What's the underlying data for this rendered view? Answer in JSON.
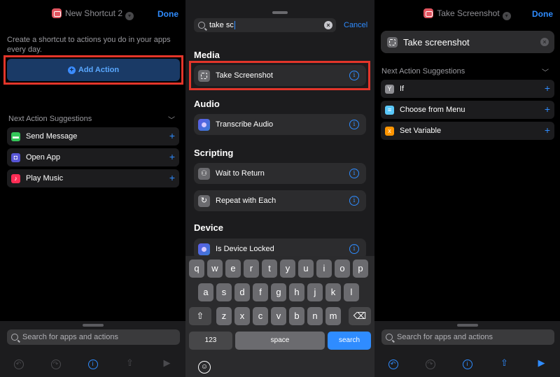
{
  "left_panel": {
    "title": "New Shortcut 2",
    "done_label": "Done",
    "intro_text": "Create a shortcut to actions you do in your apps every day.",
    "add_action_label": "Add Action",
    "suggestions_header": "Next Action Suggestions",
    "suggestions": [
      {
        "label": "Send Message",
        "icon": "message-icon",
        "color": "#34c759"
      },
      {
        "label": "Open App",
        "icon": "open-app-icon",
        "color": "#5856d6"
      },
      {
        "label": "Play Music",
        "icon": "music-icon",
        "color": "#ff2d55"
      }
    ],
    "search_placeholder": "Search for apps and actions"
  },
  "middle_panel": {
    "search_value": "take sc",
    "cancel_label": "Cancel",
    "sections": [
      {
        "title": "Media",
        "items": [
          {
            "label": "Take Screenshot",
            "icon": "screenshot-icon"
          }
        ]
      },
      {
        "title": "Audio",
        "items": [
          {
            "label": "Transcribe Audio",
            "icon": "transcribe-icon"
          }
        ]
      },
      {
        "title": "Scripting",
        "items": [
          {
            "label": "Wait to Return",
            "icon": "wait-icon"
          },
          {
            "label": "Repeat with Each",
            "icon": "repeat-icon"
          }
        ]
      },
      {
        "title": "Device",
        "items": [
          {
            "label": "Is Device Locked",
            "icon": "device-locked-icon"
          }
        ]
      }
    ],
    "keyboard": {
      "row1": [
        "q",
        "w",
        "e",
        "r",
        "t",
        "y",
        "u",
        "i",
        "o",
        "p"
      ],
      "row2": [
        "a",
        "s",
        "d",
        "f",
        "g",
        "h",
        "j",
        "k",
        "l"
      ],
      "row3": [
        "z",
        "x",
        "c",
        "v",
        "b",
        "n",
        "m"
      ],
      "numbers_label": "123",
      "space_label": "space",
      "search_label": "search"
    }
  },
  "right_panel": {
    "title": "Take Screenshot",
    "done_label": "Done",
    "action_label": "Take screenshot",
    "suggestions_header": "Next Action Suggestions",
    "suggestions": [
      {
        "label": "If",
        "icon": "if-icon",
        "color": "#8e8e93"
      },
      {
        "label": "Choose from Menu",
        "icon": "menu-icon",
        "color": "#5ac8fa"
      },
      {
        "label": "Set Variable",
        "icon": "variable-icon",
        "color": "#ff9500"
      }
    ],
    "search_placeholder": "Search for apps and actions"
  },
  "colors": {
    "accent": "#2f8cff",
    "highlight": "#e3352a"
  }
}
